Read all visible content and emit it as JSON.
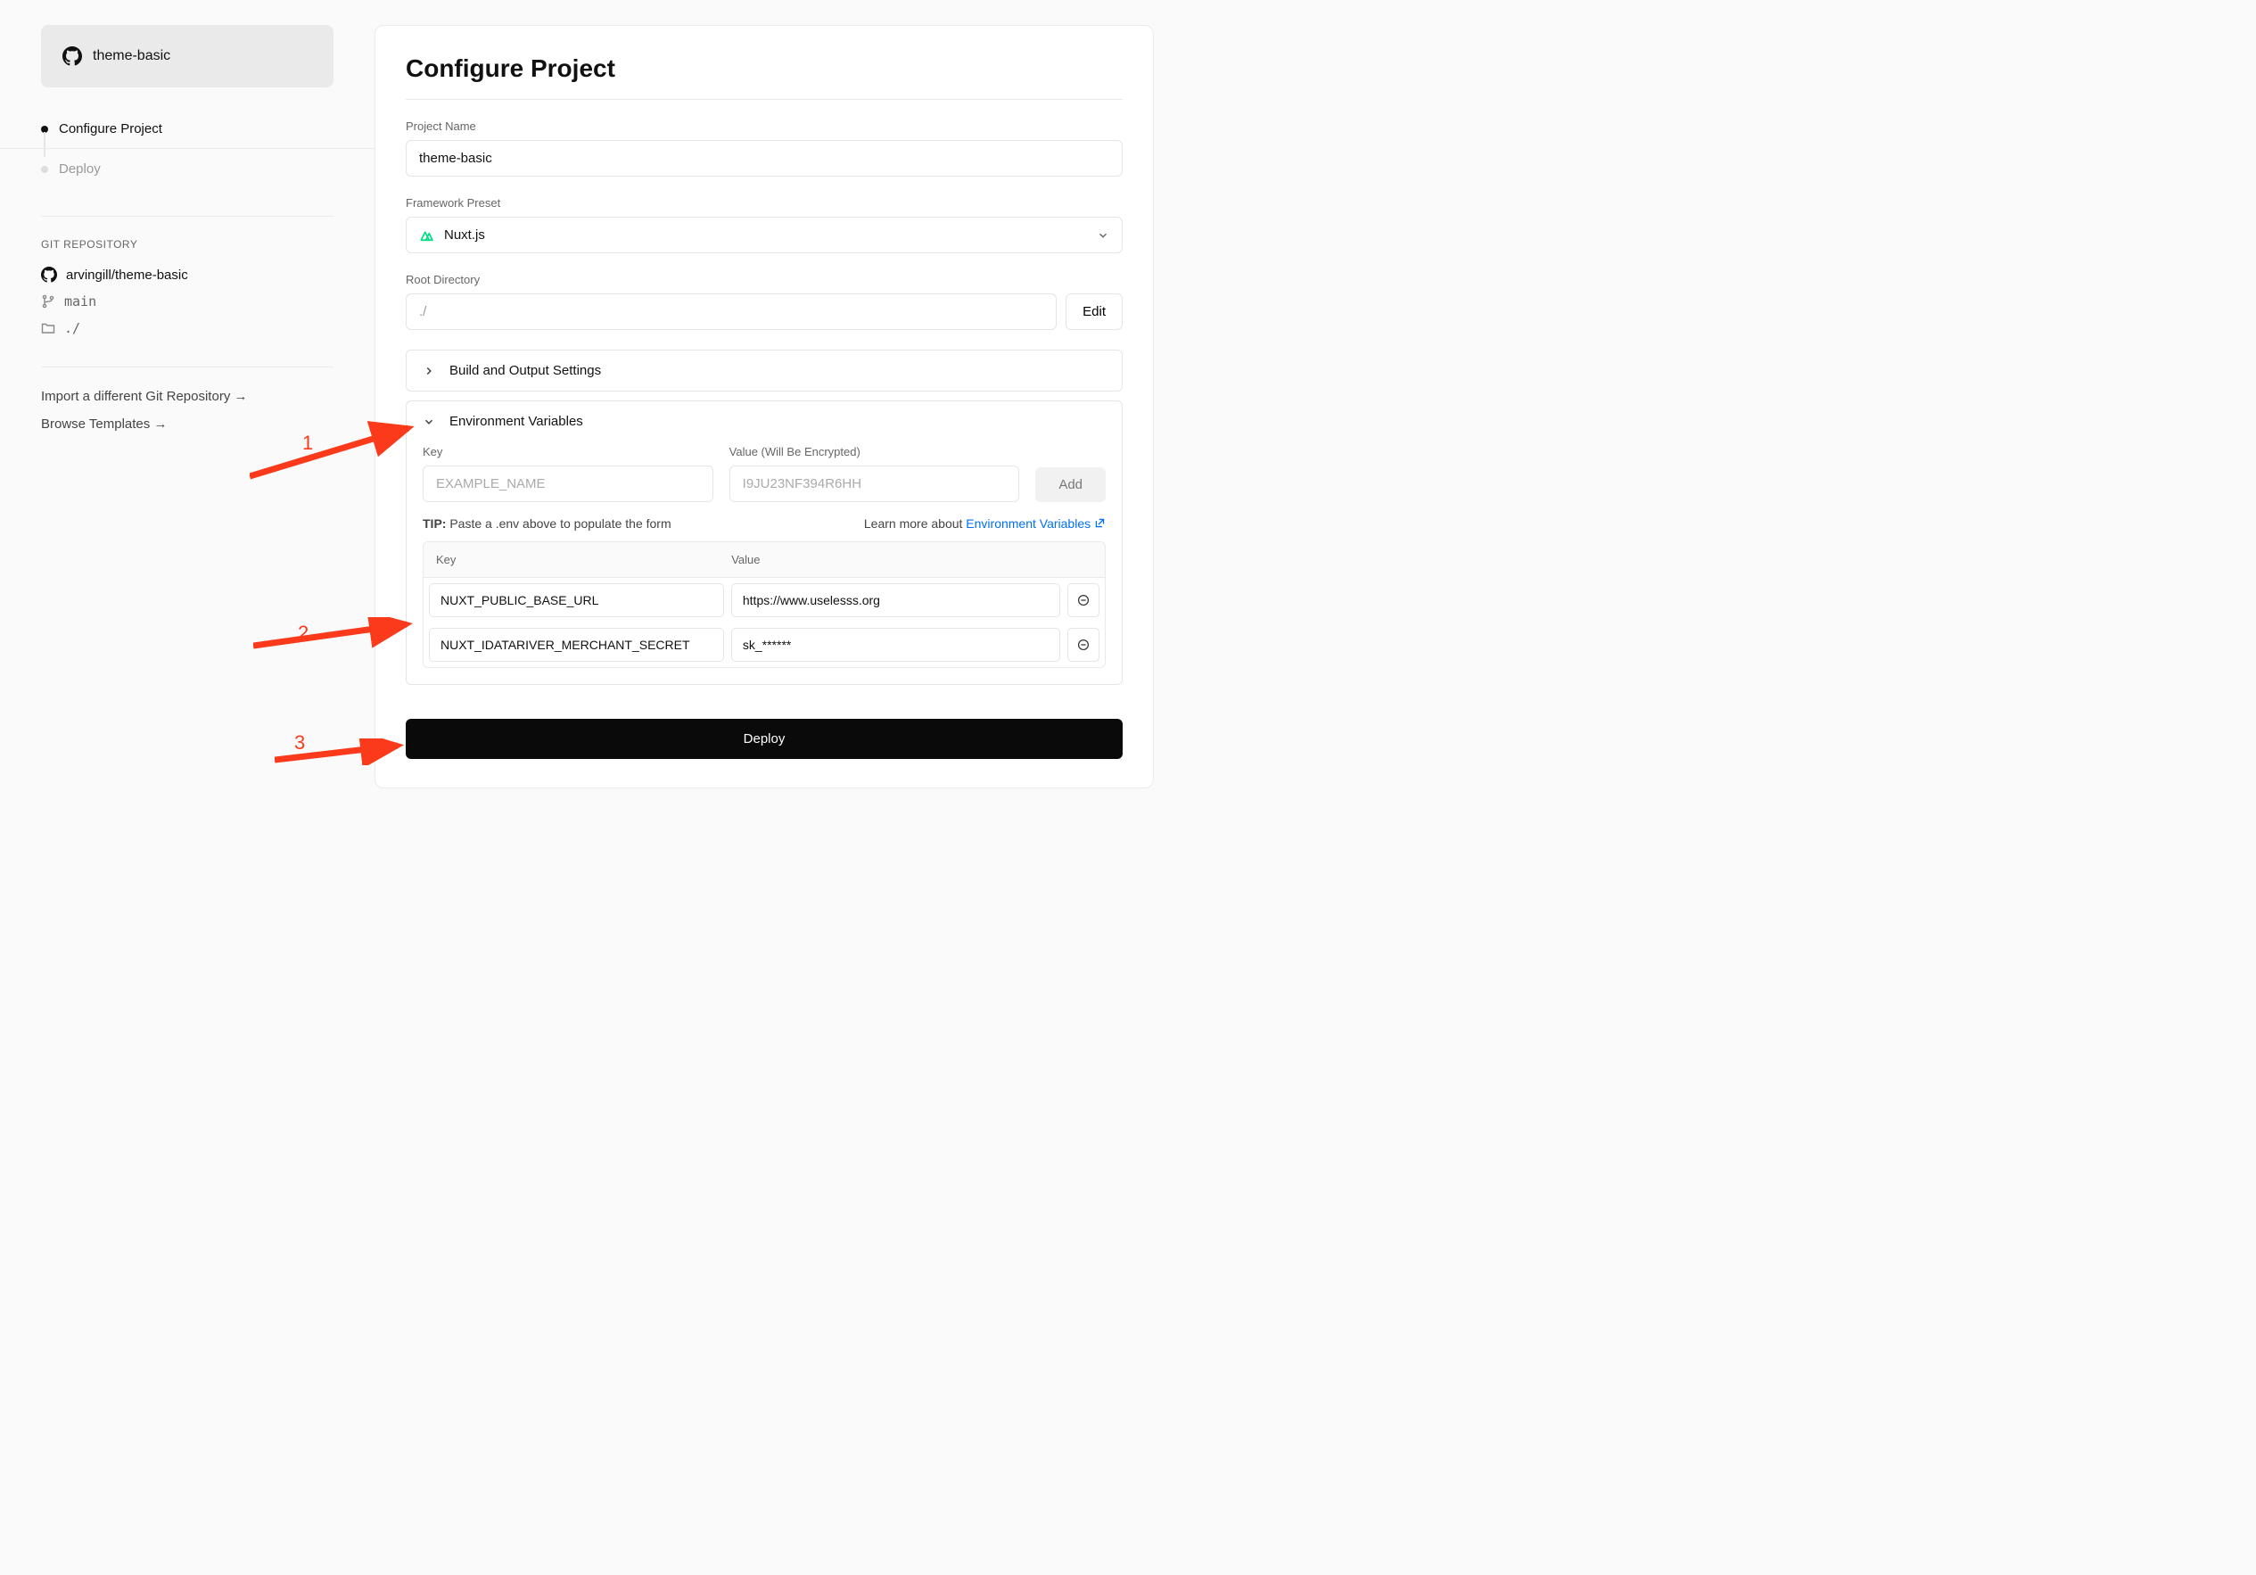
{
  "sidebar": {
    "repo_name": "theme-basic",
    "steps": [
      {
        "label": "Configure Project",
        "active": true
      },
      {
        "label": "Deploy",
        "active": false
      }
    ],
    "git_section_label": "GIT REPOSITORY",
    "git_repo": "arvingill/theme-basic",
    "git_branch": "main",
    "git_root": "./",
    "links": {
      "import": "Import a different Git Repository →",
      "browse": "Browse Templates →"
    }
  },
  "main": {
    "title": "Configure Project",
    "project_name": {
      "label": "Project Name",
      "value": "theme-basic"
    },
    "framework": {
      "label": "Framework Preset",
      "value": "Nuxt.js"
    },
    "root_dir": {
      "label": "Root Directory",
      "value": "./",
      "edit_label": "Edit"
    },
    "build_settings_label": "Build and Output Settings",
    "env": {
      "section_label": "Environment Variables",
      "key_label": "Key",
      "value_label": "Value (Will Be Encrypted)",
      "key_placeholder": "EXAMPLE_NAME",
      "value_placeholder": "I9JU23NF394R6HH",
      "add_label": "Add",
      "tip_prefix": "TIP:",
      "tip_text": " Paste a .env above to populate the form",
      "learn_prefix": "Learn more about ",
      "learn_link": "Environment Variables",
      "table": {
        "head_key": "Key",
        "head_value": "Value",
        "rows": [
          {
            "key": "NUXT_PUBLIC_BASE_URL",
            "value": "https://www.uselesss.org"
          },
          {
            "key": "NUXT_IDATARIVER_MERCHANT_SECRET",
            "value": "sk_******"
          }
        ]
      }
    },
    "deploy_label": "Deploy"
  },
  "annotations": {
    "n1": "1",
    "n2": "2",
    "n3": "3"
  }
}
